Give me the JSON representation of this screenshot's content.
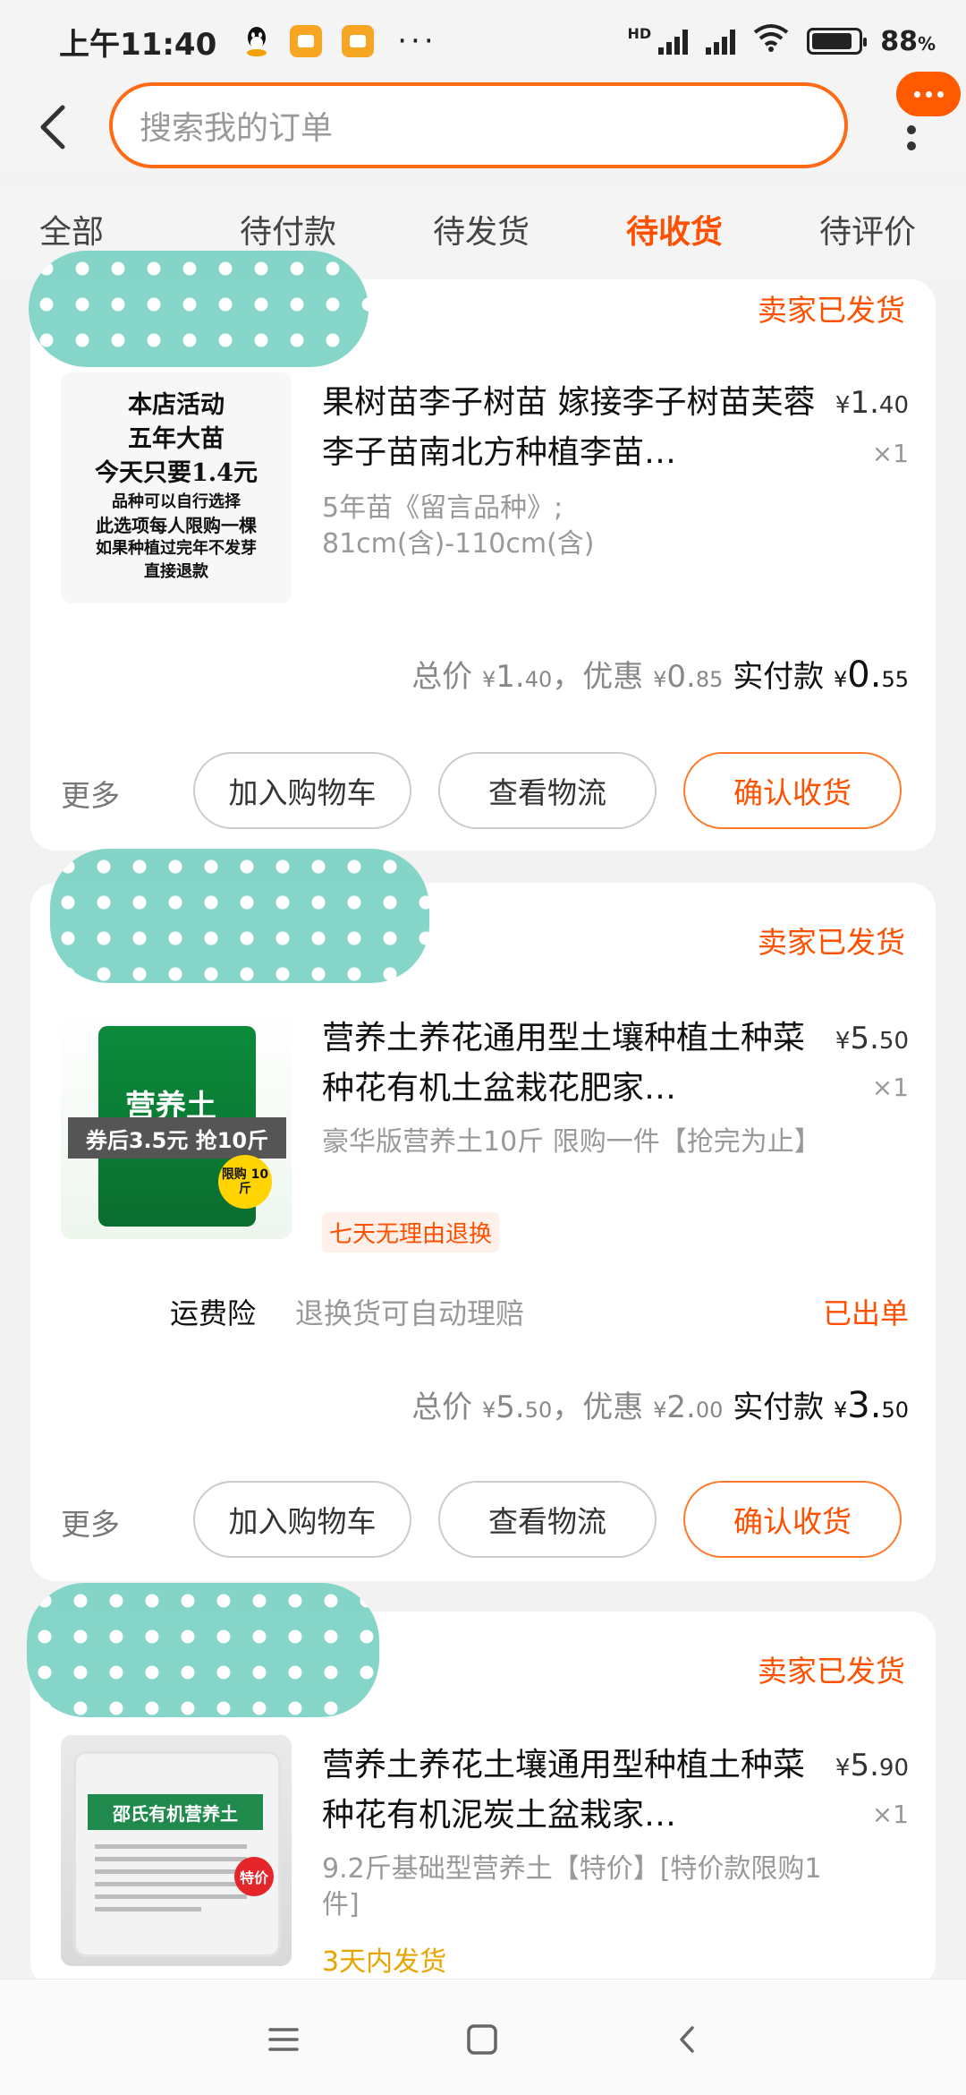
{
  "status_bar": {
    "time": "上午11:40",
    "dots": "···",
    "hd": "HD",
    "battery": "88",
    "battery_unit": "%"
  },
  "header": {
    "search_placeholder": "搜索我的订单"
  },
  "tabs": [
    {
      "label": "全部"
    },
    {
      "label": "待付款"
    },
    {
      "label": "待发货"
    },
    {
      "label": "待收货",
      "active": true
    },
    {
      "label": "待评价"
    }
  ],
  "orders": [
    {
      "status": "卖家已发货",
      "thumb_lines": [
        "本店活动",
        "五年大苗",
        "今天只要1.4元",
        "品种可以自行选择",
        "此选项每人限购一棵",
        "如果种植过完年不发芽",
        "直接退款"
      ],
      "title": "果树苗李子树苗 嫁接李子树苗芙蓉李子苗南北方种植李苗…",
      "price_int": "1.",
      "price_dec": "40",
      "qty": "×1",
      "spec": "5年苗《留言品种》;\n81cm(含)-110cm(含)",
      "total_label": "总价",
      "total_int": "1.",
      "total_dec": "40",
      "discount_label": "，优惠",
      "discount_int": "0.",
      "discount_dec": "85",
      "paid_label": "实付款",
      "paid_int": "0.",
      "paid_dec": "55",
      "more": "更多",
      "btn_cart": "加入购物车",
      "btn_logistics": "查看物流",
      "btn_confirm": "确认收货"
    },
    {
      "status": "卖家已发货",
      "thumb_brand": "营养土",
      "thumb_coupon": "券后3.5元 抢10斤",
      "thumb_badge": "限购 10斤",
      "title": "营养土养花通用型土壤种植土种菜种花有机土盆栽花肥家…",
      "price_int": "5.",
      "price_dec": "50",
      "qty": "×1",
      "spec": "豪华版营养土10斤 限购一件【抢完为止】",
      "tag": "七天无理由退换",
      "insure_label": "运费险",
      "insure_desc": "退换货可自动理赔",
      "insure_status": "已出单",
      "total_label": "总价",
      "total_int": "5.",
      "total_dec": "50",
      "discount_label": "，优惠",
      "discount_int": "2.",
      "discount_dec": "00",
      "paid_label": "实付款",
      "paid_int": "3.",
      "paid_dec": "50",
      "more": "更多",
      "btn_cart": "加入购物车",
      "btn_logistics": "查看物流",
      "btn_confirm": "确认收货"
    },
    {
      "status": "卖家已发货",
      "thumb_brand": "邵氏有机营养土",
      "thumb_badge": "特价",
      "title": "营养土养花土壤通用型种植土种菜种花有机泥炭土盆栽家…",
      "price_int": "5.",
      "price_dec": "90",
      "qty": "×1",
      "spec": "9.2斤基础型营养土【特价】[特价款限购1件]",
      "tag": "3天内发货"
    }
  ],
  "currency": "¥",
  "colors": {
    "accent": "#ff5000",
    "background": "#f2f2f2"
  }
}
